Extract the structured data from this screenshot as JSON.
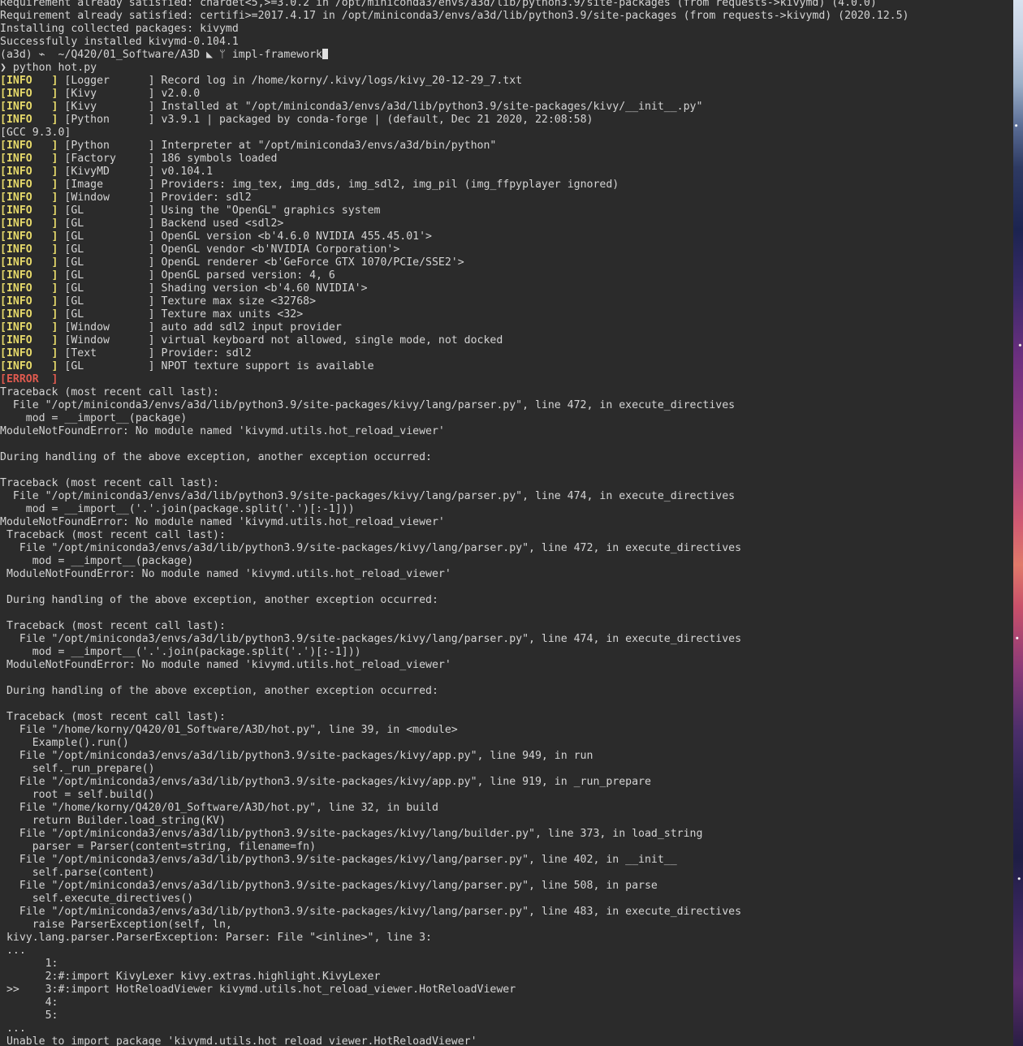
{
  "terminal": {
    "lines": [
      "Requirement already satisfied: chardet<5,>=3.0.2 in /opt/miniconda3/envs/a3d/lib/python3.9/site-packages (from requests->kivymd) (4.0.0)",
      "Requirement already satisfied: certifi>=2017.4.17 in /opt/miniconda3/envs/a3d/lib/python3.9/site-packages (from requests->kivymd) (2020.12.5)",
      "Installing collected packages: kivymd",
      "Successfully installed kivymd-0.104.1",
      "__PROMPT__",
      "❯ python hot.py",
      "__INFO__[Logger      ] Record log in /home/korny/.kivy/logs/kivy_20-12-29_7.txt",
      "__INFO__[Kivy        ] v2.0.0",
      "__INFO__[Kivy        ] Installed at \"/opt/miniconda3/envs/a3d/lib/python3.9/site-packages/kivy/__init__.py\"",
      "__INFO__[Python      ] v3.9.1 | packaged by conda-forge | (default, Dec 21 2020, 22:08:58)",
      "[GCC 9.3.0]",
      "__INFO__[Python      ] Interpreter at \"/opt/miniconda3/envs/a3d/bin/python\"",
      "__INFO__[Factory     ] 186 symbols loaded",
      "__INFO__[KivyMD      ] v0.104.1",
      "__INFO__[Image       ] Providers: img_tex, img_dds, img_sdl2, img_pil (img_ffpyplayer ignored)",
      "__INFO__[Window      ] Provider: sdl2",
      "__INFO__[GL          ] Using the \"OpenGL\" graphics system",
      "__INFO__[GL          ] Backend used <sdl2>",
      "__INFO__[GL          ] OpenGL version <b'4.6.0 NVIDIA 455.45.01'>",
      "__INFO__[GL          ] OpenGL vendor <b'NVIDIA Corporation'>",
      "__INFO__[GL          ] OpenGL renderer <b'GeForce GTX 1070/PCIe/SSE2'>",
      "__INFO__[GL          ] OpenGL parsed version: 4, 6",
      "__INFO__[GL          ] Shading version <b'4.60 NVIDIA'>",
      "__INFO__[GL          ] Texture max size <32768>",
      "__INFO__[GL          ] Texture max units <32>",
      "__INFO__[Window      ] auto add sdl2 input provider",
      "__INFO__[Window      ] virtual keyboard not allowed, single mode, not docked",
      "__INFO__[Text        ] Provider: sdl2",
      "__INFO__[GL          ] NPOT texture support is available",
      "__ERROR__",
      "Traceback (most recent call last):",
      "  File \"/opt/miniconda3/envs/a3d/lib/python3.9/site-packages/kivy/lang/parser.py\", line 472, in execute_directives",
      "    mod = __import__(package)",
      "ModuleNotFoundError: No module named 'kivymd.utils.hot_reload_viewer'",
      "",
      "During handling of the above exception, another exception occurred:",
      "",
      "Traceback (most recent call last):",
      "  File \"/opt/miniconda3/envs/a3d/lib/python3.9/site-packages/kivy/lang/parser.py\", line 474, in execute_directives",
      "    mod = __import__('.'.join(package.split('.')[:-1]))",
      "ModuleNotFoundError: No module named 'kivymd.utils.hot_reload_viewer'",
      " Traceback (most recent call last):",
      "   File \"/opt/miniconda3/envs/a3d/lib/python3.9/site-packages/kivy/lang/parser.py\", line 472, in execute_directives",
      "     mod = __import__(package)",
      " ModuleNotFoundError: No module named 'kivymd.utils.hot_reload_viewer'",
      "",
      " During handling of the above exception, another exception occurred:",
      "",
      " Traceback (most recent call last):",
      "   File \"/opt/miniconda3/envs/a3d/lib/python3.9/site-packages/kivy/lang/parser.py\", line 474, in execute_directives",
      "     mod = __import__('.'.join(package.split('.')[:-1]))",
      " ModuleNotFoundError: No module named 'kivymd.utils.hot_reload_viewer'",
      "",
      " During handling of the above exception, another exception occurred:",
      "",
      " Traceback (most recent call last):",
      "   File \"/home/korny/Q420/01_Software/A3D/hot.py\", line 39, in <module>",
      "     Example().run()",
      "   File \"/opt/miniconda3/envs/a3d/lib/python3.9/site-packages/kivy/app.py\", line 949, in run",
      "     self._run_prepare()",
      "   File \"/opt/miniconda3/envs/a3d/lib/python3.9/site-packages/kivy/app.py\", line 919, in _run_prepare",
      "     root = self.build()",
      "   File \"/home/korny/Q420/01_Software/A3D/hot.py\", line 32, in build",
      "     return Builder.load_string(KV)",
      "   File \"/opt/miniconda3/envs/a3d/lib/python3.9/site-packages/kivy/lang/builder.py\", line 373, in load_string",
      "     parser = Parser(content=string, filename=fn)",
      "   File \"/opt/miniconda3/envs/a3d/lib/python3.9/site-packages/kivy/lang/parser.py\", line 402, in __init__",
      "     self.parse(content)",
      "   File \"/opt/miniconda3/envs/a3d/lib/python3.9/site-packages/kivy/lang/parser.py\", line 508, in parse",
      "     self.execute_directives()",
      "   File \"/opt/miniconda3/envs/a3d/lib/python3.9/site-packages/kivy/lang/parser.py\", line 483, in execute_directives",
      "     raise ParserException(self, ln,",
      " kivy.lang.parser.ParserException: Parser: File \"<inline>\", line 3:",
      " ...",
      "       1:",
      "       2:#:import KivyLexer kivy.extras.highlight.KivyLexer",
      " >>    3:#:import HotReloadViewer kivymd.utils.hot_reload_viewer.HotReloadViewer",
      "       4:",
      "       5:",
      " ...",
      " Unable to import package 'kivymd.utils.hot_reload_viewer.HotReloadViewer'",
      "(a3d) ⌁  ~/Q420/01_Software/A3D ◣ ᛘ impl-framework◣"
    ],
    "prompt": {
      "env": "(a3d) ⌁  ~/Q420/01_Software/A3D ",
      "sep": "◣",
      "branch_icon": " ᛘ ",
      "branch": "impl-framework"
    },
    "level_info": "[INFO   ] ",
    "level_error": "[ERROR  ]",
    "colors": {
      "background": "#2b2b2b",
      "text": "#d4d4d4",
      "info": "#e6d96a",
      "error": "#e05a4f"
    }
  }
}
